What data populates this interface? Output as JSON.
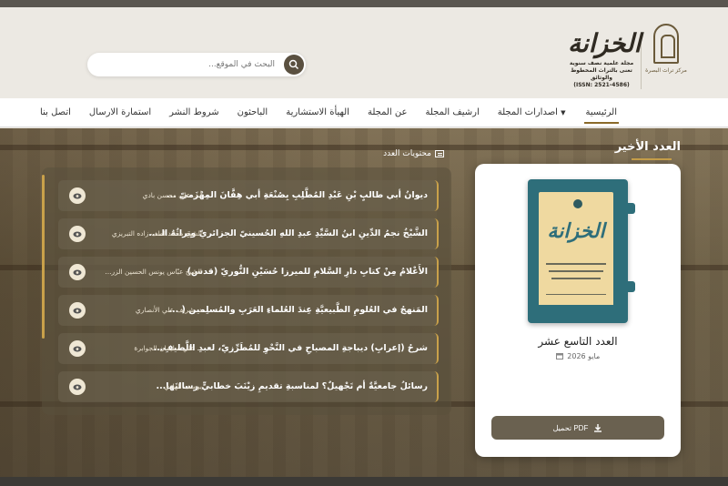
{
  "header": {
    "institution_logo_text": "مركز تراث البصرة",
    "magazine_logo_text": "الخزانة",
    "magazine_tagline": "مجلة علمية نصف سنوية تعنى بالتراث المخطوط والوثائق",
    "magazine_issn": "(ISSN: 2521-4586)"
  },
  "search": {
    "placeholder": "البحث في الموقع...",
    "icon": "search-icon"
  },
  "nav": {
    "items": [
      {
        "label": "الرئيسية",
        "active": true
      },
      {
        "label": "اصدارات المجلة",
        "dropdown": true
      },
      {
        "label": "ارشيف المجلة"
      },
      {
        "label": "عن المجلة"
      },
      {
        "label": "الهيأة الاستشارية"
      },
      {
        "label": "الباحثون"
      },
      {
        "label": "شروط النشر"
      },
      {
        "label": "استمارة الارسال"
      },
      {
        "label": "اتصل بنا"
      }
    ],
    "dropdown_glyph": "▼"
  },
  "latest": {
    "heading": "العدد الأخير",
    "issue_name": "العدد التاسع عشر",
    "issue_date": "مايو 2026",
    "cover_title": "الخزانة",
    "pdf_label": "تحميل PDF"
  },
  "contents": {
    "heading": "محتويات العدد",
    "articles": [
      {
        "title": "ديوانُ أبي طالبٍ بْنِ عَبْدِ المُطَّلِبِ بِصُنْعَةِ أبي هِفَّانَ المِهْزَميّ ...",
        "author": "أ.د. علي محسن بادي"
      },
      {
        "title": "الشَّيْخُ نجمُ الدِّينِ ابنُ السَّيِّدِ عبدِ اللهِ الحُسينيّ الجزائريّ وتراثُهُ الـ...",
        "author": "الشيخ محمّد لطف زاده التبريزي"
      },
      {
        "title": "الأَعْلامُ مِنْ كتابِ دارِ السَّلامِ للميرزا حُسَيْنِ النُّوريّ (قدس)",
        "author": "الشيخ عبّاس يونس الحسين الزر..."
      },
      {
        "title": "المَنهجُ في العُلومِ الطَّبيعيَّةِ عِندَ العُلماءِ العَرَبِ والمُسلِمين ( ...",
        "author": "د. شريف علي الأنصاري"
      },
      {
        "title": "شرحُ (إعرابِ) ديباجةِ المصباحِ في النَّحْوِ للمُطَرِّزيّ، لعبدِ اللَّطيفِ...",
        "author": "د. علي سليمان الجوابرة"
      },
      {
        "title": "رسائلُ جامعيَّةٌ أم تَجْهيلٌ؟ لمناسبةِ تقديمِ زيْنَبَ خطابيٍّ رسالتَها...",
        "author": "يوسف الهادي"
      }
    ]
  },
  "colors": {
    "accent_gold": "#c9a14a",
    "cover_teal": "#2e6e7a",
    "button_brown": "#6a6150"
  }
}
